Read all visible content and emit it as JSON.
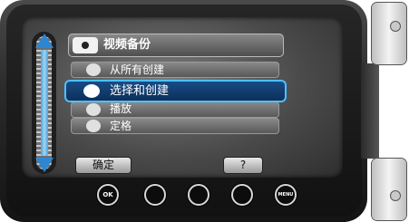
{
  "menu": {
    "title": "视频备份",
    "items": [
      {
        "label": "从所有创建",
        "selected": false
      },
      {
        "label": "选择和创建",
        "selected": true
      },
      {
        "label": "播放",
        "selected": false
      },
      {
        "label": "定格",
        "selected": false
      }
    ]
  },
  "softkeys": {
    "confirm_label": "确定",
    "help_label": "?"
  },
  "hardware_buttons": {
    "ok_label": "OK",
    "menu_label": "MENU"
  },
  "colors": {
    "selection_border": "#4fc0ff",
    "scroll_arrow": "#2e86d1"
  }
}
